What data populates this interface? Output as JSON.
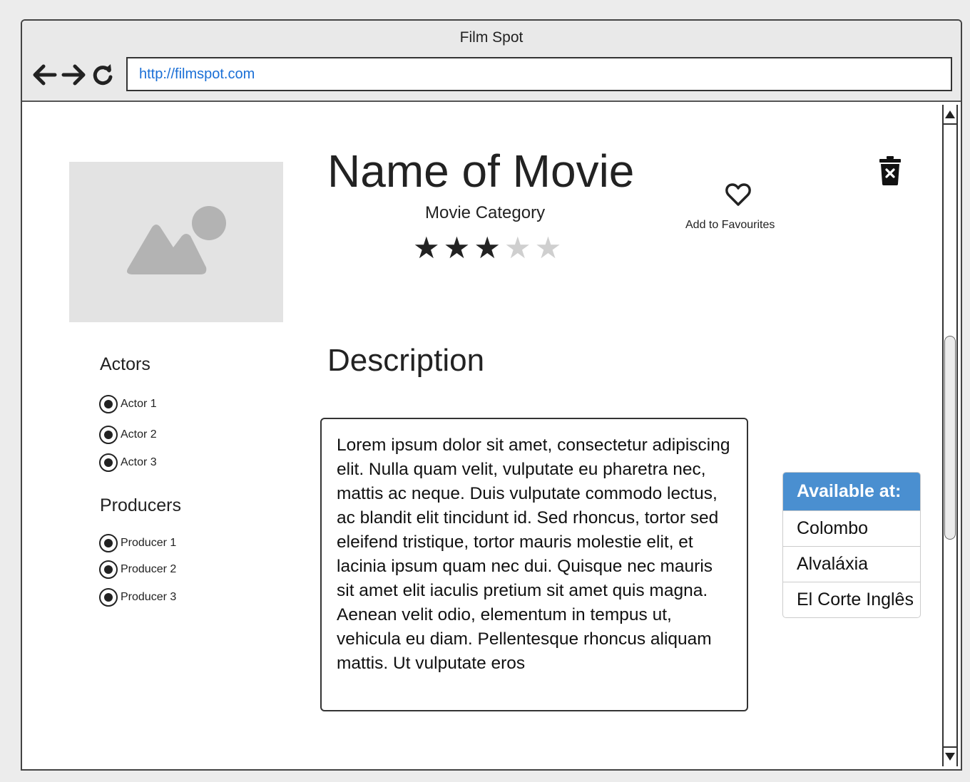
{
  "window": {
    "title": "Film Spot",
    "url": "http://filmspot.com"
  },
  "movie": {
    "title": "Name of Movie",
    "category": "Movie Category",
    "rating": 3,
    "rating_max": 5,
    "favourites_label": "Add to Favourites"
  },
  "actors": {
    "heading": "Actors",
    "items": [
      "Actor 1",
      "Actor 2",
      "Actor 3"
    ]
  },
  "producers": {
    "heading": "Producers",
    "items": [
      "Producer 1",
      "Producer 2",
      "Producer 3"
    ]
  },
  "description": {
    "heading": "Description",
    "text": "Lorem ipsum dolor sit amet, consectetur adipiscing elit. Nulla quam velit, vulputate eu pharetra nec, mattis ac neque. Duis vulputate commodo lectus, ac blandit elit tincidunt id. Sed rhoncus, tortor sed eleifend tristique, tortor mauris molestie elit, et lacinia ipsum quam nec dui. Quisque nec mauris sit amet elit iaculis pretium sit amet quis magna. Aenean velit odio, elementum in tempus ut, vehicula eu diam. Pellentesque rhoncus aliquam mattis. Ut vulputate eros"
  },
  "availability": {
    "heading": "Available at:",
    "items": [
      "Colombo",
      "Alvaláxia",
      "El Corte Inglês"
    ]
  },
  "colors": {
    "accent": "#4a8fd0",
    "link": "#1a6fd6",
    "placeholder": "#e3e3e3"
  },
  "icons": {
    "back": "arrow-left-icon",
    "forward": "arrow-right-icon",
    "reload": "reload-icon",
    "favourite": "heart-outline-icon",
    "delete": "trash-x-icon",
    "poster": "image-placeholder-icon"
  }
}
